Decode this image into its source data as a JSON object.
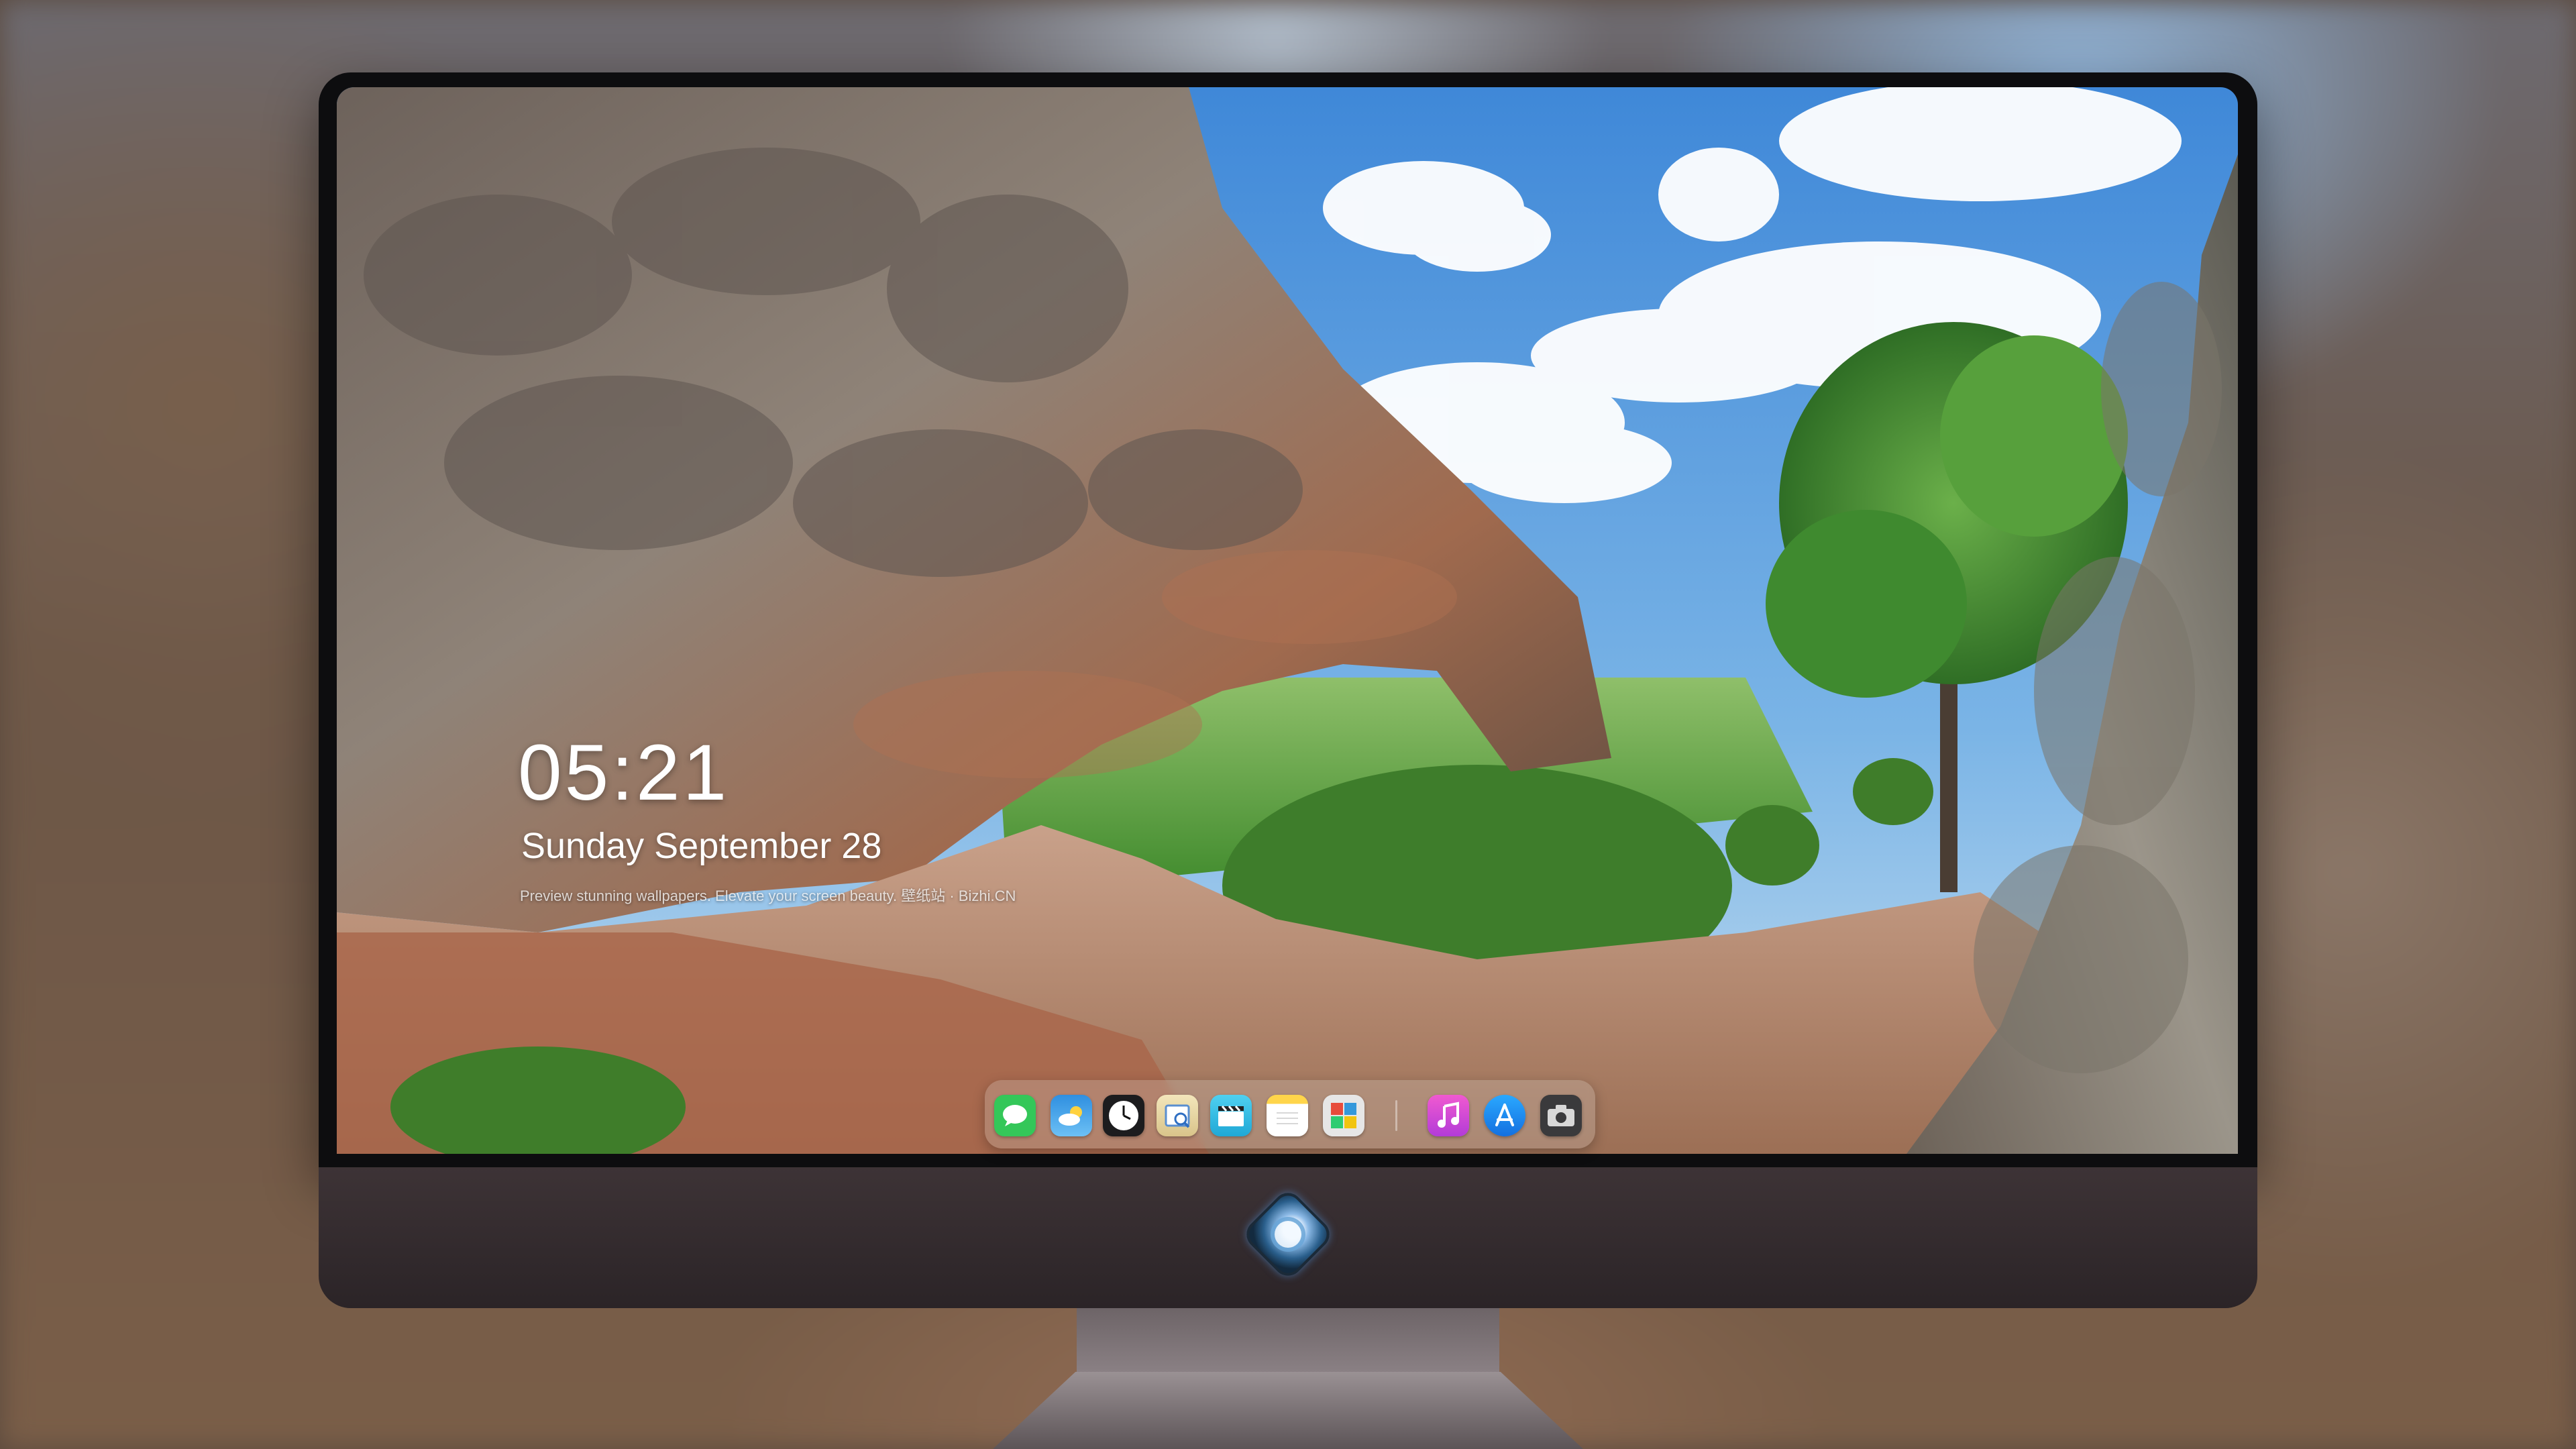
{
  "lock_screen": {
    "time": "05:21",
    "date": "Sunday September  28",
    "tagline": "Preview stunning wallpapers. Elevate your screen beauty. 壁纸站 · Bizhi.CN"
  },
  "dock": {
    "apps": [
      {
        "name": "Messages",
        "icon": "messages-icon",
        "color": "#34c759"
      },
      {
        "name": "Weather",
        "icon": "weather-icon",
        "color": "#2f8fe0"
      },
      {
        "name": "Clock",
        "icon": "clock-icon",
        "color": "#1c1c1e"
      },
      {
        "name": "Preview",
        "icon": "preview-icon",
        "color": "#e9d9a6"
      },
      {
        "name": "Clips",
        "icon": "clapperboard-icon",
        "color": "#39c0e8"
      },
      {
        "name": "Notes",
        "icon": "notes-icon",
        "color": "#ffd54a"
      },
      {
        "name": "Photo Booth",
        "icon": "photo-booth-icon",
        "color": "#e0e0e0"
      },
      {
        "name": "Music",
        "icon": "music-icon",
        "color": "#e048c8"
      },
      {
        "name": "App Store",
        "icon": "app-store-icon",
        "color": "#1e8df0"
      },
      {
        "name": "Screenshot",
        "icon": "camera-icon",
        "color": "#3a3a3c"
      }
    ]
  },
  "device": {
    "chin_logo": "mascot-logo-icon"
  },
  "colors": {
    "sky": "#4a8fd6",
    "rock": "#8a7668",
    "foliage": "#5fa23a",
    "monitor_chin": "#352d30"
  }
}
